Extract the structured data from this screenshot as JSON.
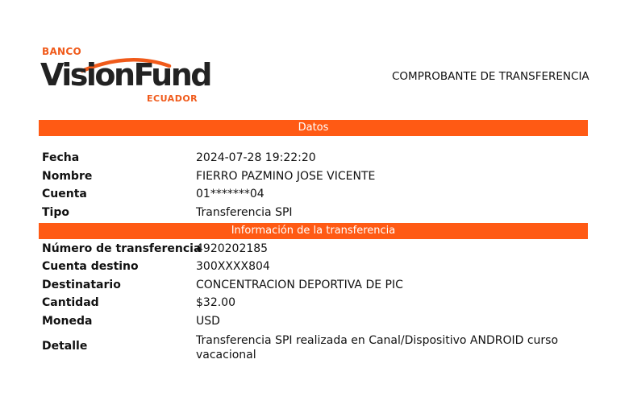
{
  "header": {
    "logo": {
      "top_text": "BANCO",
      "brand": "VisionFund",
      "country": "ECUADOR",
      "accent_color": "#f05a1a"
    },
    "title": "COMPROBANTE DE TRANSFERENCIA"
  },
  "sections": [
    {
      "title": "Datos",
      "rows": [
        {
          "label": "Fecha",
          "value": "2024-07-28 19:22:20"
        },
        {
          "label": "Nombre",
          "value": "FIERRO PAZMINO JOSE VICENTE"
        },
        {
          "label": "Cuenta",
          "value": "01*******04"
        },
        {
          "label": "Tipo",
          "value": "Transferencia SPI"
        }
      ]
    },
    {
      "title": "Información de la transferencia",
      "rows": [
        {
          "label": "Número de transferencia",
          "value": "4920202185"
        },
        {
          "label": "Cuenta destino",
          "value": "300XXXX804"
        },
        {
          "label": "Destinatario",
          "value": "CONCENTRACION DEPORTIVA DE PIC"
        },
        {
          "label": "Cantidad",
          "value": "$32.00"
        },
        {
          "label": "Moneda",
          "value": "USD"
        },
        {
          "label": "Detalle",
          "value": "Transferencia SPI realizada en Canal/Dispositivo ANDROID curso vacacional"
        }
      ]
    }
  ],
  "colors": {
    "band": "#ff5a14",
    "band_text": "#ffffff"
  }
}
